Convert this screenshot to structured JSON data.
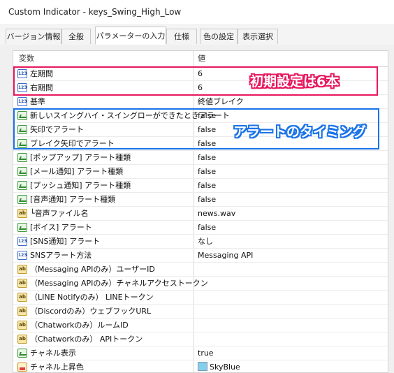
{
  "window": {
    "title": "Custom Indicator - keys_Swing_High_Low"
  },
  "tabs": [
    {
      "label": "バージョン情報"
    },
    {
      "label": "全般"
    },
    {
      "label": "パラメーターの入力"
    },
    {
      "label": "仕様"
    },
    {
      "label": "色の設定"
    },
    {
      "label": "表示選択"
    }
  ],
  "active_tab": "パラメーターの入力",
  "grid": {
    "headers": {
      "variable": "変数",
      "value": "値"
    },
    "rows": [
      {
        "icon": "number-icon",
        "name": "左期間",
        "value": "6"
      },
      {
        "icon": "number-icon",
        "name": "右期間",
        "value": "6"
      },
      {
        "icon": "number-icon",
        "name": "基準",
        "value": "終値ブレイク"
      },
      {
        "icon": "boolean-icon",
        "name": "新しいスイングハイ・スイングローができたときアラート",
        "value": "false"
      },
      {
        "icon": "boolean-icon",
        "name": "矢印でアラート",
        "value": "false"
      },
      {
        "icon": "boolean-icon",
        "name": "ブレイク矢印でアラート",
        "value": "false"
      },
      {
        "icon": "boolean-icon",
        "name": "[ポップアップ] アラート種類",
        "value": "false"
      },
      {
        "icon": "boolean-icon",
        "name": "[メール通知] アラート種類",
        "value": "false"
      },
      {
        "icon": "boolean-icon",
        "name": "[プッシュ通知] アラート種類",
        "value": "false"
      },
      {
        "icon": "boolean-icon",
        "name": "[音声通知] アラート種類",
        "value": "false"
      },
      {
        "icon": "string-icon",
        "name": " └音声ファイル名",
        "value": "news.wav"
      },
      {
        "icon": "boolean-icon",
        "name": "[ボイス] アラート",
        "value": "false"
      },
      {
        "icon": "number-icon",
        "name": "[SNS通知] アラート",
        "value": "なし"
      },
      {
        "icon": "number-icon",
        "name": "SNSアラート方法",
        "value": "Messaging API"
      },
      {
        "icon": "string-icon",
        "name": "（Messaging APIのみ）ユーザーID",
        "value": ""
      },
      {
        "icon": "string-icon",
        "name": "（Messaging APIのみ）チャネルアクセストークン",
        "value": ""
      },
      {
        "icon": "string-icon",
        "name": "（LINE Notifyのみ） LINEトークン",
        "value": ""
      },
      {
        "icon": "string-icon",
        "name": "（Discordのみ）ウェブフックURL",
        "value": ""
      },
      {
        "icon": "string-icon",
        "name": "（Chatworkのみ）ルームID",
        "value": ""
      },
      {
        "icon": "string-icon",
        "name": "（Chatworkのみ） APIトークン",
        "value": ""
      },
      {
        "icon": "boolean-icon",
        "name": "チャネル表示",
        "value": "true"
      },
      {
        "icon": "color-icon",
        "name": "チャネル上昇色",
        "value": "SkyBlue",
        "color": "#87CEEB"
      }
    ]
  },
  "annotations": {
    "red": {
      "text": "初期設定は6本",
      "color": "#e8175d"
    },
    "blue": {
      "text": "アラートのタイミング",
      "color": "#1a73e8"
    }
  }
}
